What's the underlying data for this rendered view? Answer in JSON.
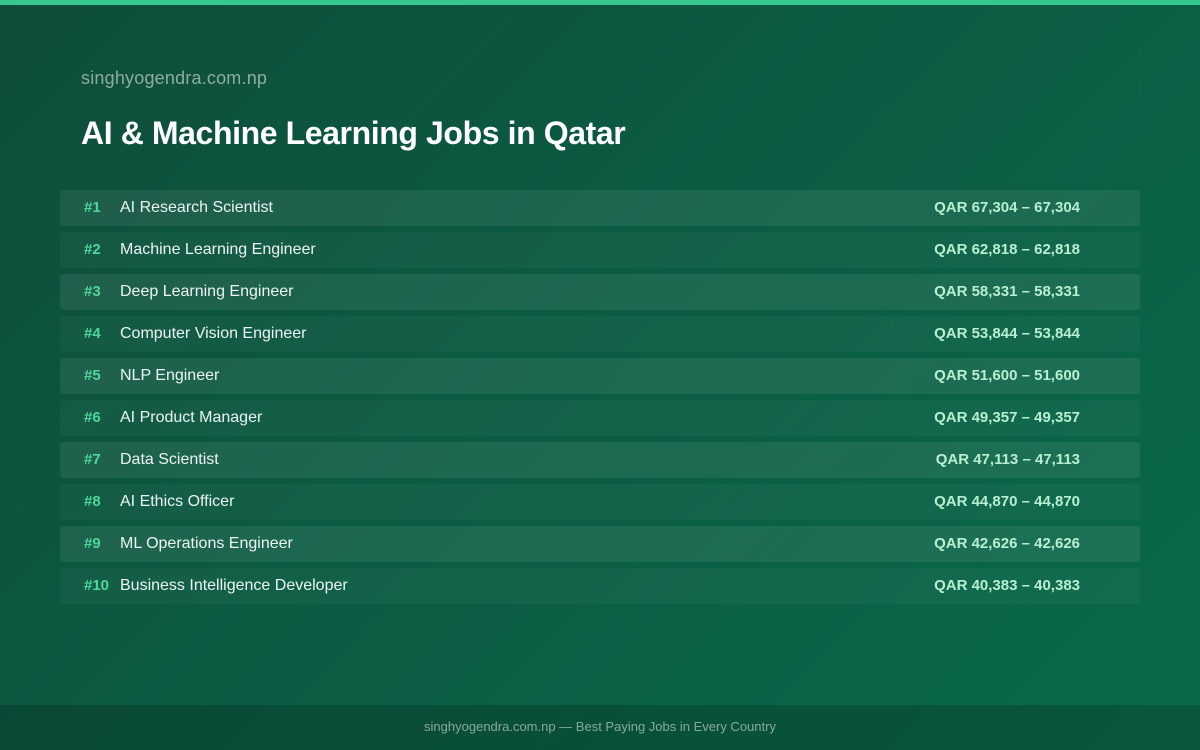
{
  "header": {
    "site_url": "singhyogendra.com.np",
    "title": "AI & Machine Learning Jobs in Qatar"
  },
  "jobs": [
    {
      "rank": "#1",
      "title": "AI Research Scientist",
      "salary": "QAR 67,304 – 67,304"
    },
    {
      "rank": "#2",
      "title": "Machine Learning Engineer",
      "salary": "QAR 62,818 – 62,818"
    },
    {
      "rank": "#3",
      "title": "Deep Learning Engineer",
      "salary": "QAR 58,331 – 58,331"
    },
    {
      "rank": "#4",
      "title": "Computer Vision Engineer",
      "salary": "QAR 53,844 – 53,844"
    },
    {
      "rank": "#5",
      "title": "NLP Engineer",
      "salary": "QAR 51,600 – 51,600"
    },
    {
      "rank": "#6",
      "title": "AI Product Manager",
      "salary": "QAR 49,357 – 49,357"
    },
    {
      "rank": "#7",
      "title": "Data Scientist",
      "salary": "QAR 47,113 – 47,113"
    },
    {
      "rank": "#8",
      "title": "AI Ethics Officer",
      "salary": "QAR 44,870 – 44,870"
    },
    {
      "rank": "#9",
      "title": "ML Operations Engineer",
      "salary": "QAR 42,626 – 42,626"
    },
    {
      "rank": "#10",
      "title": "Business Intelligence Developer",
      "salary": "QAR 40,383 – 40,383"
    }
  ],
  "footer": {
    "text": "singhyogendra.com.np — Best Paying Jobs in Every Country"
  },
  "colors": {
    "accent": "#35c98f",
    "background_start": "#0f4d3a",
    "background_end": "#0a6a4b",
    "rank": "#4fd69a",
    "salary": "#b8efd0"
  }
}
